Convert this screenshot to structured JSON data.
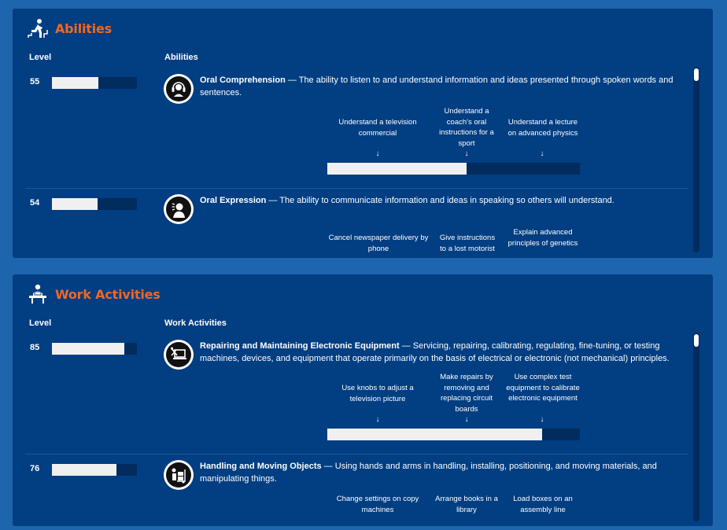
{
  "abilities": {
    "title": "Abilities",
    "col_level": "Level",
    "col_name": "Abilities",
    "items": [
      {
        "level": "55",
        "level_value": 55,
        "name": "Oral Comprehension",
        "separator": " — ",
        "description": "The ability to listen to and understand information and ideas presented through spoken words and sentences.",
        "icon": "headphones-person-icon",
        "anchors": [
          "Understand a television commercial",
          "Understand a coach's oral instructions for a sport",
          "Understand a lecture on advanced physics"
        ],
        "scale_value": 55
      },
      {
        "level": "54",
        "level_value": 54,
        "name": "Oral Expression",
        "separator": " — ",
        "description": "The ability to communicate information and ideas in speaking so others will understand.",
        "icon": "speaking-person-icon",
        "anchors": [
          "Cancel newspaper delivery by phone",
          "Give instructions to a lost motorist",
          "Explain advanced principles of genetics"
        ]
      }
    ]
  },
  "work_activities": {
    "title": "Work Activities",
    "col_level": "Level",
    "col_name": "Work Activities",
    "items": [
      {
        "level": "85",
        "level_value": 85,
        "name": "Repairing and Maintaining Electronic Equipment",
        "separator": " — ",
        "description": "Servicing, repairing, calibrating, regulating, fine-tuning, or testing machines, devices, and equipment that operate primarily on the basis of electrical or electronic (not mechanical) principles.",
        "icon": "laptop-tools-icon",
        "anchors": [
          "Use knobs to adjust a television picture",
          "Make repairs by removing and replacing circuit boards",
          "Use complex test equipment to calibrate electronic equipment"
        ],
        "scale_value": 85
      },
      {
        "level": "76",
        "level_value": 76,
        "name": "Handling and Moving Objects",
        "separator": " — ",
        "description": "Using hands and arms in handling, installing, positioning, and moving materials, and manipulating things.",
        "icon": "hand-truck-icon",
        "anchors": [
          "Change settings on copy machines",
          "Arrange books in a library",
          "Load boxes on an assembly line"
        ]
      }
    ]
  }
}
